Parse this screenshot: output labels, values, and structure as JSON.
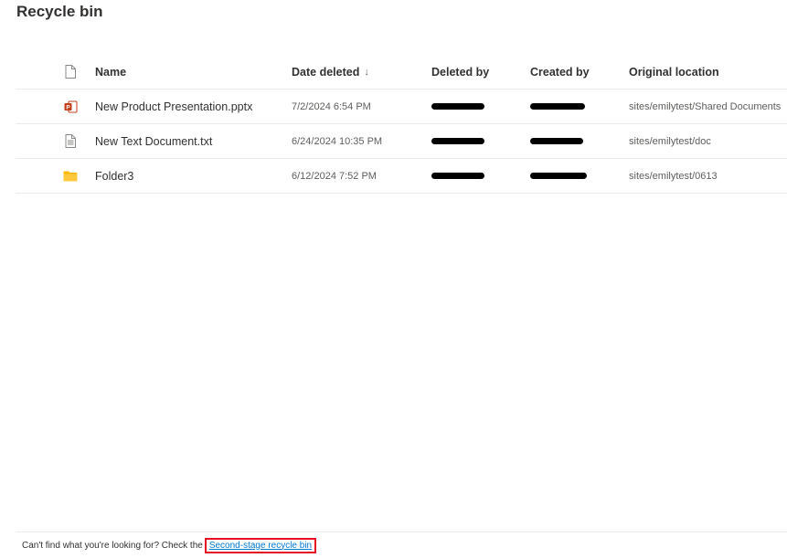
{
  "page": {
    "title": "Recycle bin"
  },
  "table": {
    "columns": {
      "name": "Name",
      "date_deleted": "Date deleted",
      "sort_indicator": "↓",
      "deleted_by": "Deleted by",
      "created_by": "Created by",
      "original_location": "Original location"
    },
    "rows": [
      {
        "icon": "powerpoint-file-icon",
        "name": "New Product Presentation.pptx",
        "date_deleted": "7/2/2024 6:54 PM",
        "deleted_by": "[redacted]",
        "created_by": "[redacted]",
        "original_location": "sites/emilytest/Shared Documents"
      },
      {
        "icon": "text-file-icon",
        "name": "New Text Document.txt",
        "date_deleted": "6/24/2024 10:35 PM",
        "deleted_by": "[redacted]",
        "created_by": "[redacted]",
        "original_location": "sites/emilytest/doc"
      },
      {
        "icon": "folder-icon",
        "name": "Folder3",
        "date_deleted": "6/12/2024 7:52 PM",
        "deleted_by": "[redacted]",
        "created_by": "[redacted]",
        "original_location": "sites/emilytest/0613"
      }
    ]
  },
  "footer": {
    "text": "Can't find what you're looking for? Check the",
    "link": "Second-stage recycle bin"
  },
  "colors": {
    "link": "#0078d4",
    "highlight_box": "#e81123",
    "folder": "#ffb900",
    "powerpoint": "#c43e1c"
  }
}
